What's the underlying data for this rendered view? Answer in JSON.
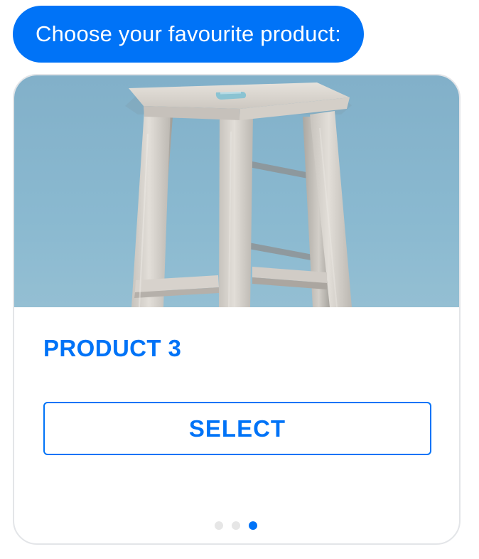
{
  "chat": {
    "message": "Choose your favourite product:",
    "bubble_color": "#0073f7"
  },
  "product_card": {
    "image_icon": "stool-photo",
    "title": "PRODUCT 3",
    "button_label": "SELECT",
    "accent_color": "#0073f7",
    "pagination": {
      "total": 3,
      "current": 3
    }
  }
}
